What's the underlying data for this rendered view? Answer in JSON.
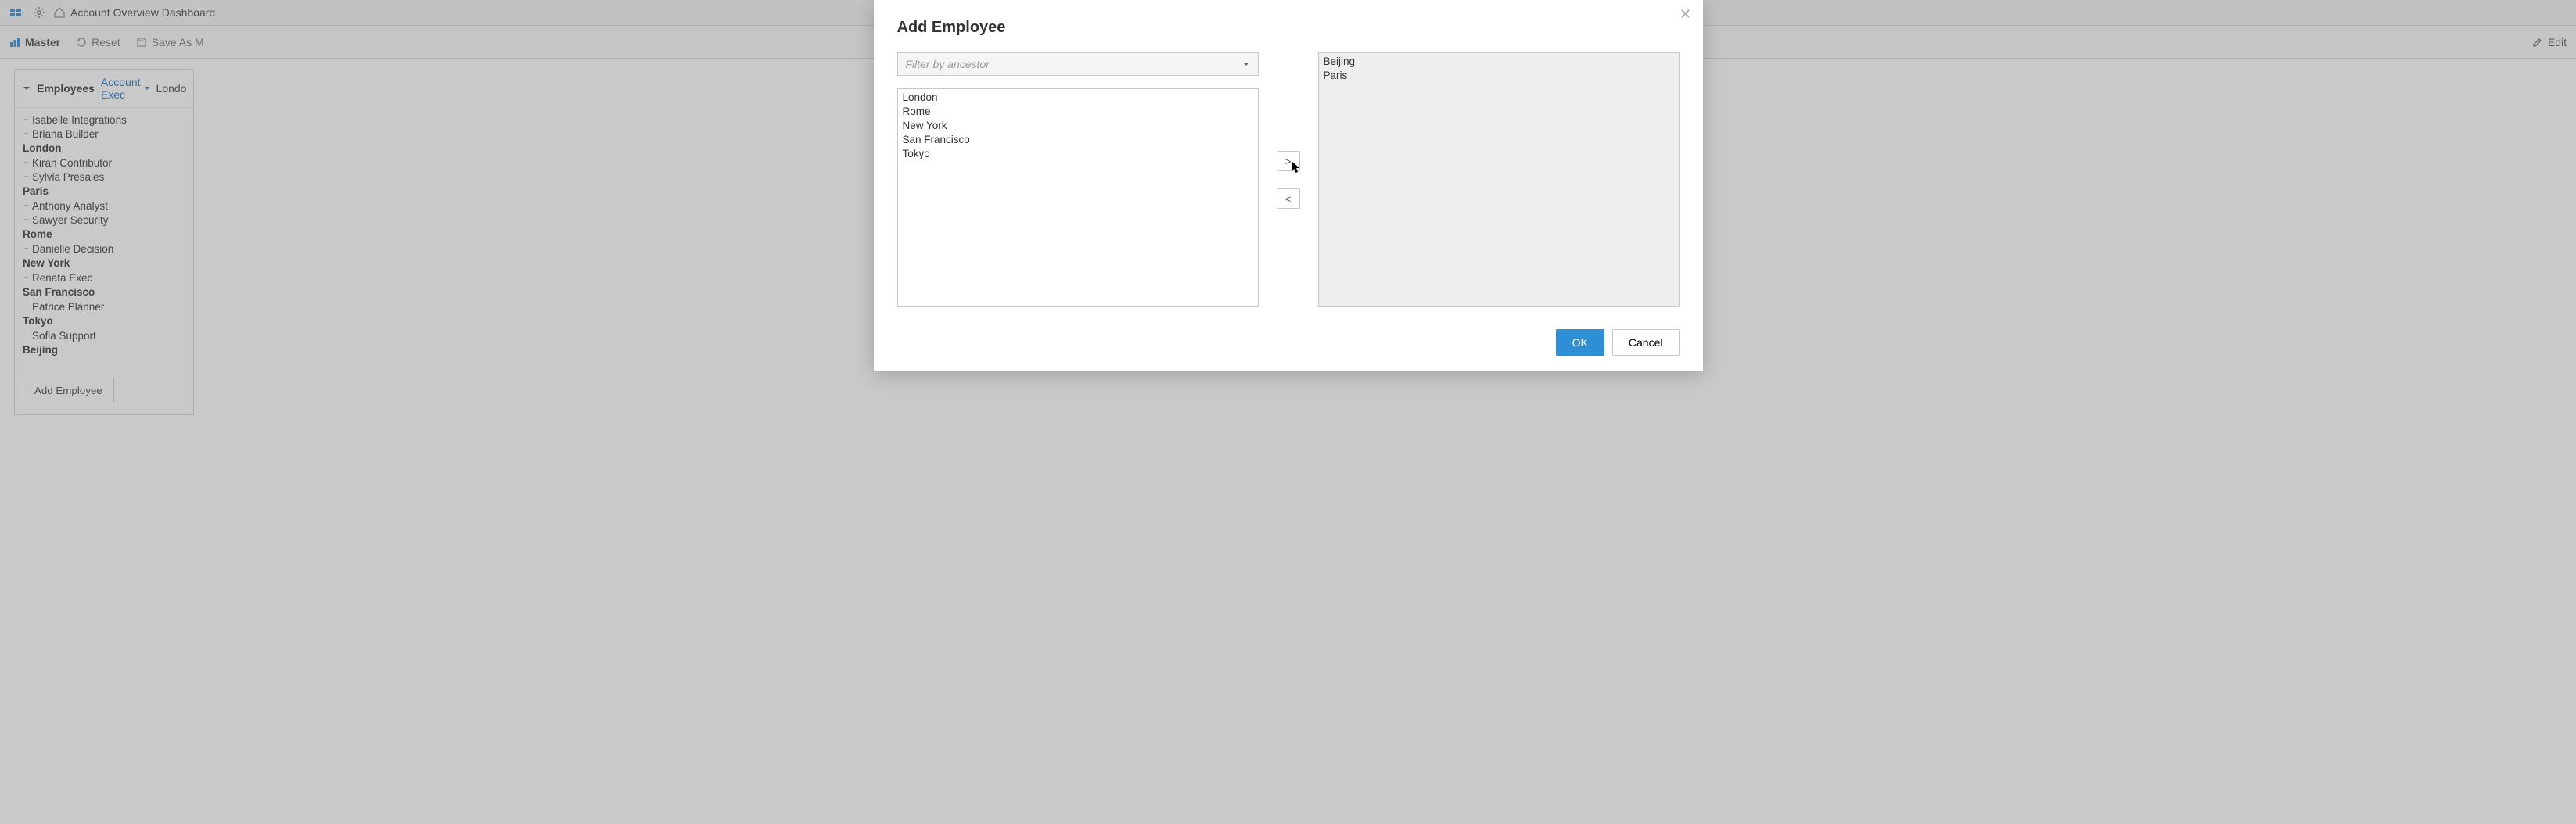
{
  "header": {
    "breadcrumb": "Account Overview Dashboard"
  },
  "toolbar": {
    "master": "Master",
    "reset": "Reset",
    "save_as": "Save As M",
    "edit": "Edit"
  },
  "tree": {
    "title": "Employees",
    "filter_link": "Account Exec",
    "after_link": "Londo",
    "groups": [
      {
        "name": "",
        "items": [
          "Isabelle Integrations",
          "Briana Builder"
        ]
      },
      {
        "name": "London",
        "items": [
          "Kiran Contributor",
          "Sylvia Presales"
        ]
      },
      {
        "name": "Paris",
        "items": [
          "Anthony Analyst",
          "Sawyer Security"
        ]
      },
      {
        "name": "Rome",
        "items": [
          "Danielle Decision"
        ]
      },
      {
        "name": "New York",
        "items": [
          "Renata Exec"
        ]
      },
      {
        "name": "San Francisco",
        "items": [
          "Patrice Planner"
        ]
      },
      {
        "name": "Tokyo",
        "items": [
          "Sofia Support"
        ]
      },
      {
        "name": "Beijing",
        "items": []
      }
    ],
    "add_button": "Add Employee"
  },
  "modal": {
    "title": "Add Employee",
    "filter_placeholder": "Filter by ancestor",
    "available": [
      "London",
      "Rome",
      "New York",
      "San Francisco",
      "Tokyo"
    ],
    "selected": [
      "Beijing",
      "Paris"
    ],
    "move_right": ">",
    "move_left": "<",
    "ok": "OK",
    "cancel": "Cancel"
  }
}
